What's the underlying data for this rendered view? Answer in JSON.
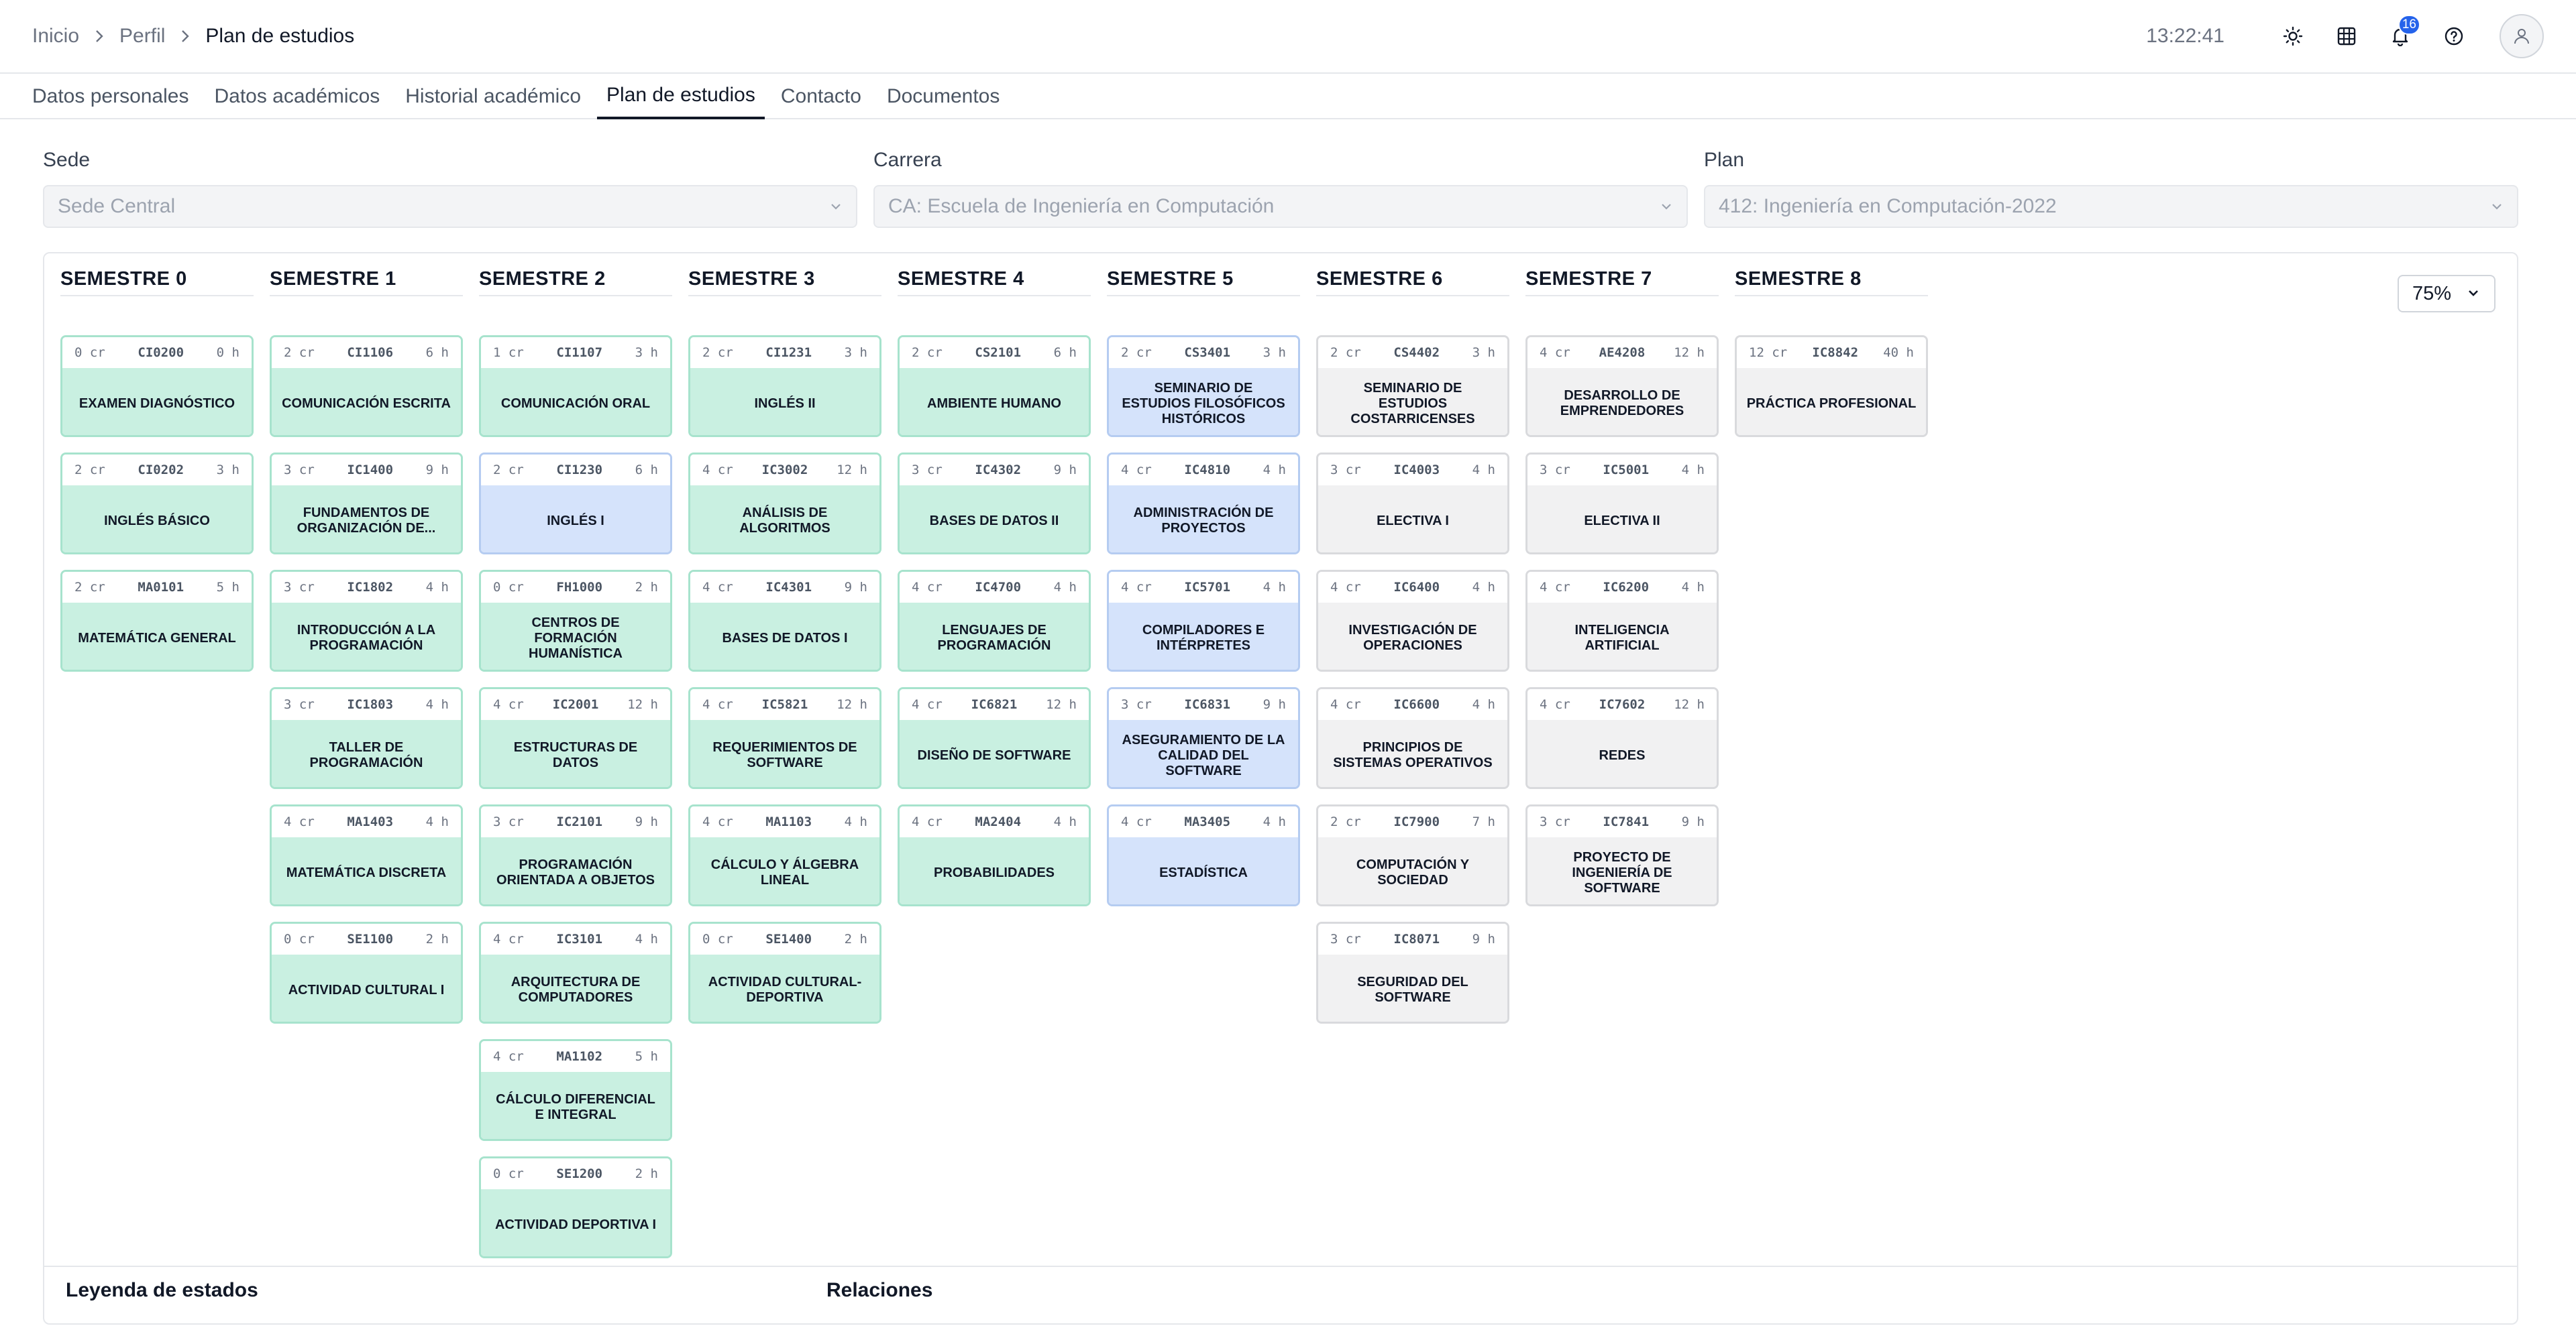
{
  "breadcrumb": [
    "Inicio",
    "Perfil",
    "Plan de estudios"
  ],
  "clock": "13:22:41",
  "notifications": {
    "count": "16"
  },
  "header_icons": [
    "sun-icon",
    "grid-icon",
    "bell-icon",
    "help-icon",
    "user-icon"
  ],
  "tabs": [
    {
      "label": "Datos personales",
      "active": false
    },
    {
      "label": "Datos académicos",
      "active": false
    },
    {
      "label": "Historial académico",
      "active": false
    },
    {
      "label": "Plan de estudios",
      "active": true
    },
    {
      "label": "Contacto",
      "active": false
    },
    {
      "label": "Documentos",
      "active": false
    }
  ],
  "filters": {
    "sede": {
      "label": "Sede",
      "value": "Sede Central"
    },
    "carrera": {
      "label": "Carrera",
      "value": "CA: Escuela de Ingeniería en Computación"
    },
    "plan": {
      "label": "Plan",
      "value": "412: Ingeniería en Computación-2022"
    }
  },
  "zoom": "75%",
  "colors": {
    "approved": "#c9f0e1",
    "in_progress": "#d5e3fb",
    "pending": "#f1f1f2"
  },
  "semesters": [
    {
      "title": "SEMESTRE 0",
      "courses": [
        {
          "cr": "0 cr",
          "code": "CI0200",
          "h": "0 h",
          "name": "Examen diagnóstico",
          "status": "green"
        },
        {
          "cr": "2 cr",
          "code": "CI0202",
          "h": "3 h",
          "name": "Inglés básico",
          "status": "green"
        },
        {
          "cr": "2 cr",
          "code": "MA0101",
          "h": "5 h",
          "name": "Matemática general",
          "status": "green"
        }
      ]
    },
    {
      "title": "SEMESTRE 1",
      "courses": [
        {
          "cr": "2 cr",
          "code": "CI1106",
          "h": "6 h",
          "name": "Comunicación escrita",
          "status": "green"
        },
        {
          "cr": "3 cr",
          "code": "IC1400",
          "h": "9 h",
          "name": "Fundamentos de organización de...",
          "status": "green"
        },
        {
          "cr": "3 cr",
          "code": "IC1802",
          "h": "4 h",
          "name": "Introducción a la programación",
          "status": "green"
        },
        {
          "cr": "3 cr",
          "code": "IC1803",
          "h": "4 h",
          "name": "Taller de programación",
          "status": "green"
        },
        {
          "cr": "4 cr",
          "code": "MA1403",
          "h": "4 h",
          "name": "Matemática discreta",
          "status": "green"
        },
        {
          "cr": "0 cr",
          "code": "SE1100",
          "h": "2 h",
          "name": "Actividad cultural I",
          "status": "green"
        }
      ]
    },
    {
      "title": "SEMESTRE 2",
      "courses": [
        {
          "cr": "1 cr",
          "code": "CI1107",
          "h": "3 h",
          "name": "Comunicación oral",
          "status": "green"
        },
        {
          "cr": "2 cr",
          "code": "CI1230",
          "h": "6 h",
          "name": "Inglés I",
          "status": "blue"
        },
        {
          "cr": "0 cr",
          "code": "FH1000",
          "h": "2 h",
          "name": "Centros de formación humanística",
          "status": "green"
        },
        {
          "cr": "4 cr",
          "code": "IC2001",
          "h": "12 h",
          "name": "Estructuras de datos",
          "status": "green"
        },
        {
          "cr": "3 cr",
          "code": "IC2101",
          "h": "9 h",
          "name": "Programación orientada a objetos",
          "status": "green"
        },
        {
          "cr": "4 cr",
          "code": "IC3101",
          "h": "4 h",
          "name": "Arquitectura de computadores",
          "status": "green"
        },
        {
          "cr": "4 cr",
          "code": "MA1102",
          "h": "5 h",
          "name": "Cálculo diferencial e integral",
          "status": "green"
        },
        {
          "cr": "0 cr",
          "code": "SE1200",
          "h": "2 h",
          "name": "Actividad deportiva I",
          "status": "green"
        }
      ]
    },
    {
      "title": "SEMESTRE 3",
      "courses": [
        {
          "cr": "2 cr",
          "code": "CI1231",
          "h": "3 h",
          "name": "Inglés II",
          "status": "green"
        },
        {
          "cr": "4 cr",
          "code": "IC3002",
          "h": "12 h",
          "name": "Análisis de algoritmos",
          "status": "green"
        },
        {
          "cr": "4 cr",
          "code": "IC4301",
          "h": "9 h",
          "name": "Bases de datos I",
          "status": "green"
        },
        {
          "cr": "4 cr",
          "code": "IC5821",
          "h": "12 h",
          "name": "Requerimientos de software",
          "status": "green"
        },
        {
          "cr": "4 cr",
          "code": "MA1103",
          "h": "4 h",
          "name": "Cálculo y álgebra lineal",
          "status": "green"
        },
        {
          "cr": "0 cr",
          "code": "SE1400",
          "h": "2 h",
          "name": "Actividad cultural-deportiva",
          "status": "green"
        }
      ]
    },
    {
      "title": "SEMESTRE 4",
      "courses": [
        {
          "cr": "2 cr",
          "code": "CS2101",
          "h": "6 h",
          "name": "Ambiente humano",
          "status": "green"
        },
        {
          "cr": "3 cr",
          "code": "IC4302",
          "h": "9 h",
          "name": "Bases de datos II",
          "status": "green"
        },
        {
          "cr": "4 cr",
          "code": "IC4700",
          "h": "4 h",
          "name": "Lenguajes de programación",
          "status": "green"
        },
        {
          "cr": "4 cr",
          "code": "IC6821",
          "h": "12 h",
          "name": "Diseño de software",
          "status": "green"
        },
        {
          "cr": "4 cr",
          "code": "MA2404",
          "h": "4 h",
          "name": "Probabilidades",
          "status": "green"
        }
      ]
    },
    {
      "title": "SEMESTRE 5",
      "courses": [
        {
          "cr": "2 cr",
          "code": "CS3401",
          "h": "3 h",
          "name": "Seminario de estudios filosóficos históricos",
          "status": "blue"
        },
        {
          "cr": "4 cr",
          "code": "IC4810",
          "h": "4 h",
          "name": "Administración de proyectos",
          "status": "blue"
        },
        {
          "cr": "4 cr",
          "code": "IC5701",
          "h": "4 h",
          "name": "Compiladores e intérpretes",
          "status": "blue"
        },
        {
          "cr": "3 cr",
          "code": "IC6831",
          "h": "9 h",
          "name": "Aseguramiento de la calidad del software",
          "status": "blue"
        },
        {
          "cr": "4 cr",
          "code": "MA3405",
          "h": "4 h",
          "name": "Estadística",
          "status": "blue"
        }
      ]
    },
    {
      "title": "SEMESTRE 6",
      "courses": [
        {
          "cr": "2 cr",
          "code": "CS4402",
          "h": "3 h",
          "name": "Seminario de estudios costarricenses",
          "status": "gray"
        },
        {
          "cr": "3 cr",
          "code": "IC4003",
          "h": "4 h",
          "name": "Electiva I",
          "status": "gray"
        },
        {
          "cr": "4 cr",
          "code": "IC6400",
          "h": "4 h",
          "name": "Investigación de operaciones",
          "status": "gray"
        },
        {
          "cr": "4 cr",
          "code": "IC6600",
          "h": "4 h",
          "name": "Principios de sistemas operativos",
          "status": "gray"
        },
        {
          "cr": "2 cr",
          "code": "IC7900",
          "h": "7 h",
          "name": "Computación y sociedad",
          "status": "gray"
        },
        {
          "cr": "3 cr",
          "code": "IC8071",
          "h": "9 h",
          "name": "Seguridad del software",
          "status": "gray"
        }
      ]
    },
    {
      "title": "SEMESTRE 7",
      "courses": [
        {
          "cr": "4 cr",
          "code": "AE4208",
          "h": "12 h",
          "name": "Desarrollo de emprendedores",
          "status": "gray"
        },
        {
          "cr": "3 cr",
          "code": "IC5001",
          "h": "4 h",
          "name": "Electiva II",
          "status": "gray"
        },
        {
          "cr": "4 cr",
          "code": "IC6200",
          "h": "4 h",
          "name": "Inteligencia artificial",
          "status": "gray"
        },
        {
          "cr": "4 cr",
          "code": "IC7602",
          "h": "12 h",
          "name": "Redes",
          "status": "gray"
        },
        {
          "cr": "3 cr",
          "code": "IC7841",
          "h": "9 h",
          "name": "Proyecto de ingeniería de software",
          "status": "gray"
        }
      ]
    },
    {
      "title": "SEMESTRE 8",
      "courses": [
        {
          "cr": "12 cr",
          "code": "IC8842",
          "h": "40 h",
          "name": "Práctica profesional",
          "status": "gray"
        }
      ]
    }
  ],
  "legend": {
    "estados": "Leyenda de estados",
    "relaciones": "Relaciones"
  }
}
